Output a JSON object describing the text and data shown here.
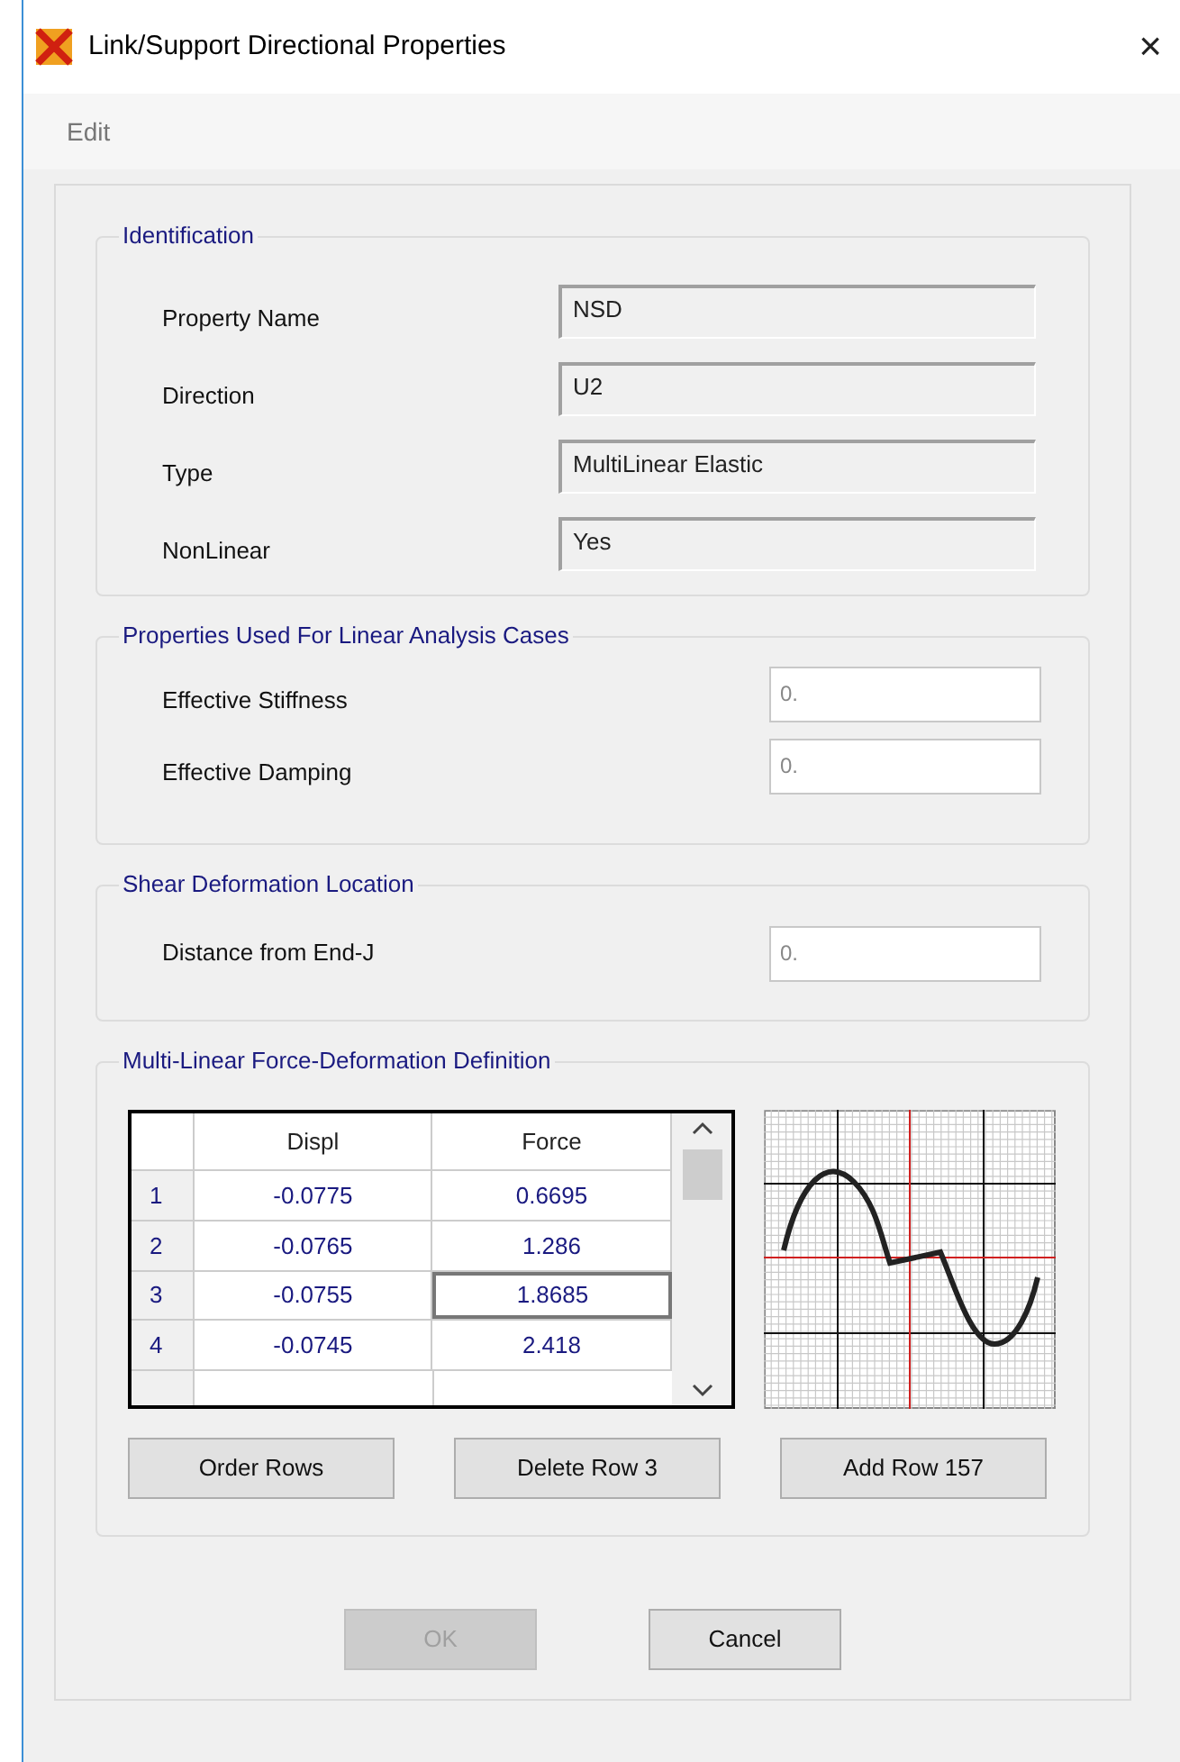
{
  "window": {
    "title": "Link/Support Directional Properties",
    "close": "×"
  },
  "menu": [
    "Edit"
  ],
  "identification": {
    "title": "Identification",
    "fields": [
      {
        "label": "Property Name",
        "value": "NSD"
      },
      {
        "label": "Direction",
        "value": "U2"
      },
      {
        "label": "Type",
        "value": "MultiLinear Elastic"
      },
      {
        "label": "NonLinear",
        "value": "Yes"
      }
    ]
  },
  "linear": {
    "title": "Properties Used For Linear Analysis Cases",
    "fields": [
      {
        "label": "Effective Stiffness",
        "value": "0."
      },
      {
        "label": "Effective Damping",
        "value": "0."
      }
    ]
  },
  "shear": {
    "title": "Shear Deformation Location",
    "fields": [
      {
        "label": "Distance from End-J",
        "value": "0."
      }
    ]
  },
  "multilinear": {
    "title": "Multi-Linear Force-Deformation Definition",
    "table": {
      "columns": [
        "Displ",
        "Force"
      ],
      "rows": [
        {
          "index": "1",
          "displ": "-0.0775",
          "force": "0.6695",
          "selected": false
        },
        {
          "index": "2",
          "displ": "-0.0765",
          "force": "1.286",
          "selected": false
        },
        {
          "index": "3",
          "displ": "-0.0755",
          "force": "1.8685",
          "selected": true
        },
        {
          "index": "4",
          "displ": "-0.0745",
          "force": "2.418",
          "selected": false
        }
      ]
    },
    "buttons": [
      "Order Rows",
      "Delete Row 3",
      "Add Row 157"
    ]
  },
  "footer_buttons": [
    {
      "label": "OK",
      "disabled": true
    },
    {
      "label": "Cancel",
      "disabled": false
    }
  ]
}
